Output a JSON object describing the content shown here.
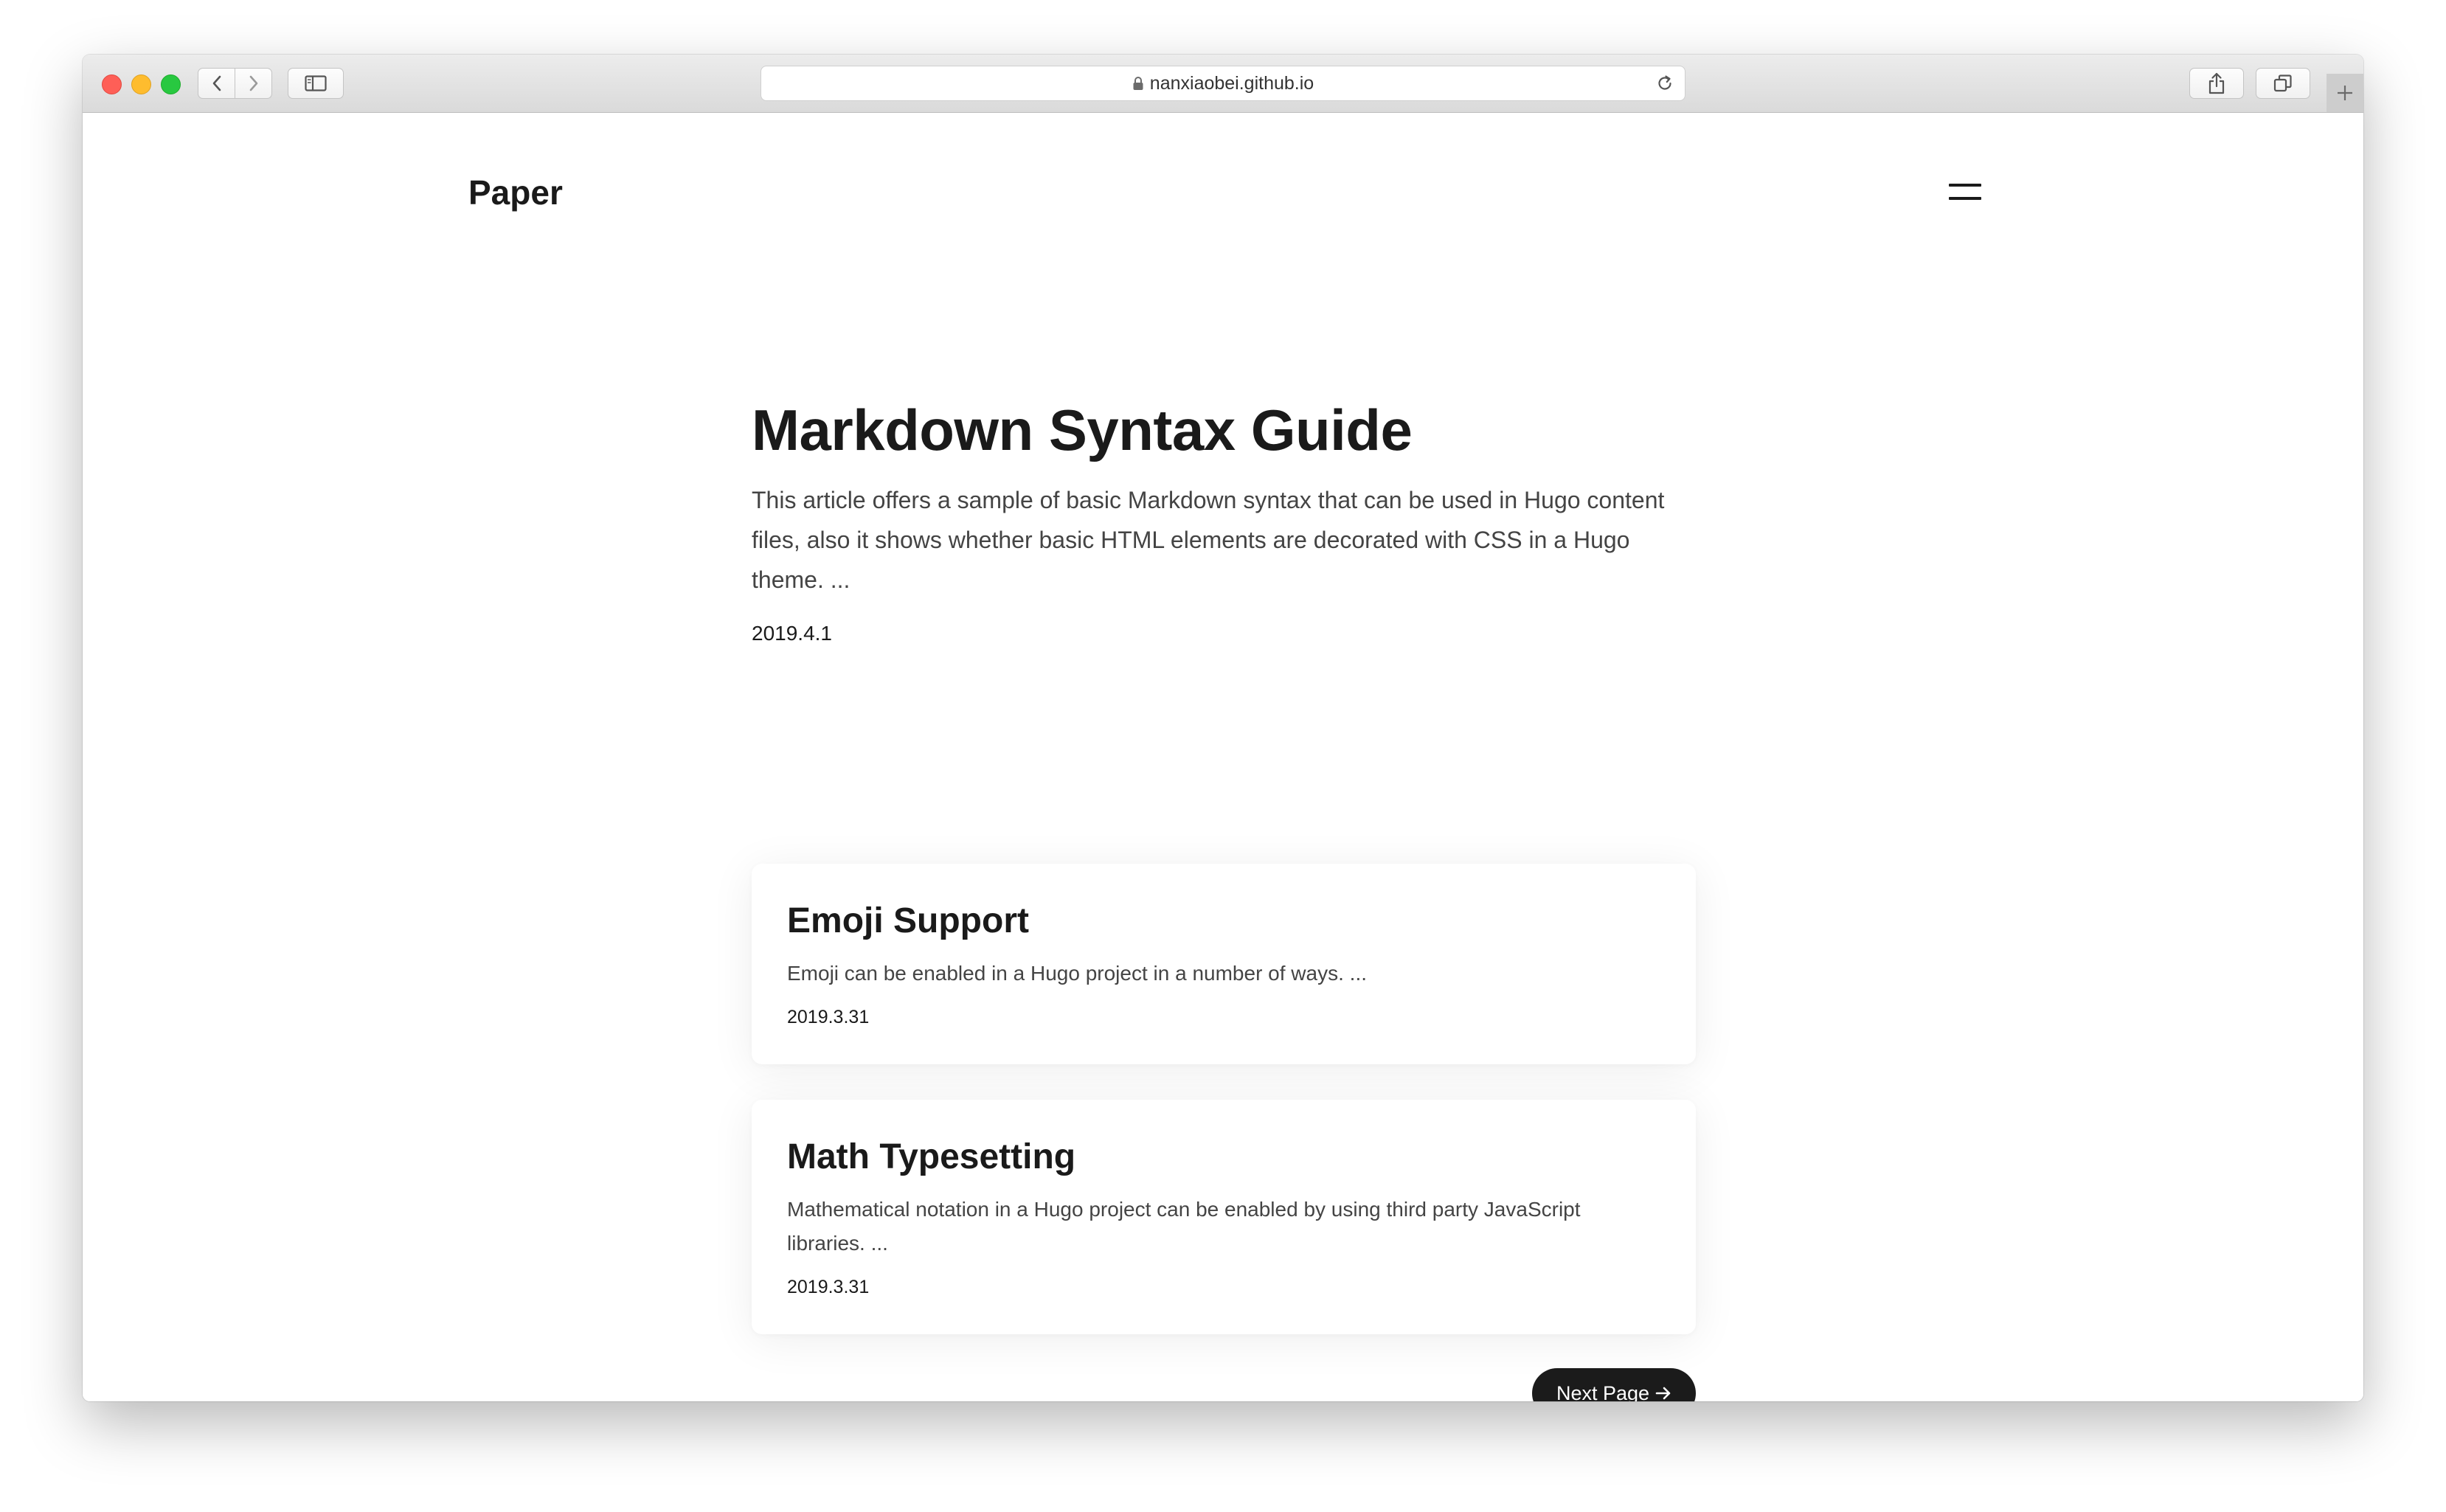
{
  "browser": {
    "url": "nanxiaobei.github.io",
    "icons": {
      "back": "chevron-left-icon",
      "forward": "chevron-right-icon",
      "sidebar": "sidebar-icon",
      "lock": "lock-icon",
      "reload": "reload-icon",
      "share": "share-icon",
      "tabs": "tabs-icon",
      "new_tab": "plus-icon"
    }
  },
  "site": {
    "brand": "Paper",
    "menu_icon": "hamburger-menu-icon"
  },
  "hero": {
    "title": "Markdown Syntax Guide",
    "summary": "This article offers a sample of basic Markdown syntax that can be used in Hugo content files, also it shows whether basic HTML elements are decorated with CSS in a Hugo theme. ...",
    "date": "2019.4.1"
  },
  "posts": [
    {
      "title": "Emoji Support",
      "summary": "Emoji can be enabled in a Hugo project in a number of ways. ...",
      "date": "2019.3.31"
    },
    {
      "title": "Math Typesetting",
      "summary": "Mathematical notation in a Hugo project can be enabled by using third party JavaScript libraries. ...",
      "date": "2019.3.31"
    }
  ],
  "pagination": {
    "next_label": "Next Page"
  },
  "colors": {
    "accent": "#1b1b1b",
    "text": "#1a1a1a",
    "muted": "#444444"
  }
}
